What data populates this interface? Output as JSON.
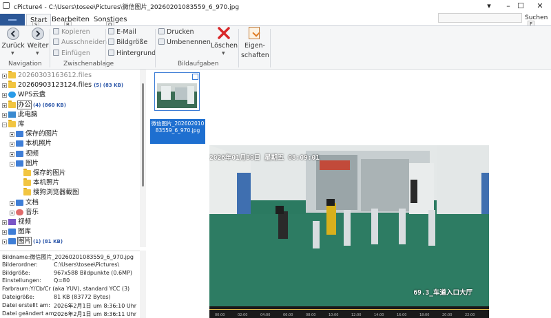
{
  "window": {
    "title": "cPicture4 - C:\\Users\\tosee\\Pictures\\微信图片_20260201083559_6_970.jpg",
    "minimize": "–",
    "maximize": "☐",
    "close": "✕"
  },
  "tabs": [
    {
      "label": "Start",
      "key": "S"
    },
    {
      "label": "Bearbeiten",
      "key": "B"
    },
    {
      "label": "Sonstiges",
      "key": "O"
    }
  ],
  "search": {
    "button_label": "Suchen",
    "key": "F",
    "value": ""
  },
  "ribbon": {
    "navigation": {
      "label": "Navigation",
      "back": "Zurück",
      "forward": "Weiter"
    },
    "clipboard": {
      "label": "Zwischenablage",
      "copy": "Kopieren",
      "cut": "Ausschneiden",
      "paste": "Einfügen"
    },
    "image": {
      "email": "E-Mail",
      "resize": "Bildgröße",
      "wallpaper": "Hintergrund"
    },
    "tasks": {
      "label": "Bildaufgaben",
      "print": "Drucken",
      "rename": "Umbenennen",
      "delete": "Löschen",
      "properties_line1": "Eigen-",
      "properties_line2": "schaften"
    }
  },
  "tree": [
    {
      "label": "20260303163612.files",
      "count": "",
      "icon": "folder",
      "exp": "plus"
    },
    {
      "label": "20260903123124.files",
      "count": "(5) (83 KB)",
      "icon": "folder",
      "exp": "plus"
    },
    {
      "label": "WPS云盘",
      "count": "",
      "icon": "cloud",
      "exp": "plus"
    },
    {
      "label": "办公",
      "count": "(4) (860 KB)",
      "icon": "folder",
      "exp": "plus"
    },
    {
      "label": "此电脑",
      "count": "",
      "icon": "pc",
      "exp": "plus"
    },
    {
      "label": "库",
      "count": "",
      "icon": "folder",
      "exp": "minus"
    },
    {
      "label": "保存的图片",
      "count": "",
      "icon": "lib",
      "exp": "plus"
    },
    {
      "label": "本机照片",
      "count": "",
      "icon": "lib",
      "exp": "plus"
    },
    {
      "label": "视频",
      "count": "",
      "icon": "lib",
      "exp": "plus"
    },
    {
      "label": "图片",
      "count": "",
      "icon": "lib",
      "exp": "minus"
    },
    {
      "label": "保存的图片",
      "count": "",
      "icon": "folder",
      "exp": ""
    },
    {
      "label": "本机照片",
      "count": "",
      "icon": "folder",
      "exp": ""
    },
    {
      "label": "搜狗浏览器截图",
      "count": "",
      "icon": "folder",
      "exp": ""
    },
    {
      "label": "文档",
      "count": "",
      "icon": "lib",
      "exp": "plus"
    },
    {
      "label": "音乐",
      "count": "",
      "icon": "music",
      "exp": "plus"
    },
    {
      "label": "视频",
      "count": "",
      "icon": "video",
      "exp": "plus"
    },
    {
      "label": "图库",
      "count": "",
      "icon": "lib",
      "exp": "plus"
    },
    {
      "label": "图片",
      "count": "(1) (81 KB)",
      "icon": "lib",
      "exp": "plus"
    }
  ],
  "info": [
    {
      "label": "Bildname:",
      "value": "微信图片_20260201083559_6_970.jpg",
      "wide": true
    },
    {
      "label": "Bilderordner:",
      "value": "C:\\Users\\tosee\\Pictures\\"
    },
    {
      "label": "Bildgröße:",
      "value": "967x588 Bildpunkte (0.6MP)"
    },
    {
      "label": "Einstellungen:",
      "value": "Q=80"
    },
    {
      "label": "Farbraum:",
      "value": "Y/Cb/Cr (aka YUV), standard YCC (3)",
      "wide": true
    },
    {
      "label": "Dateigröße:",
      "value": "81 KB (83772 Bytes)"
    },
    {
      "label": "Datei erstellt am:",
      "value": "2026年2月1日 um 8:36:10 Uhr"
    },
    {
      "label": "Datei geändert am:",
      "value": "2026年2月1日 um 8:36:11 Uhr"
    }
  ],
  "thumbnail": {
    "caption": "微信图片_20260201083559_6_970.jpg"
  },
  "preview": {
    "osd_time": "2026年01月30日  星期五  08:09:01",
    "osd_camera": "69.3_车道入口大厅",
    "timeline_ticks": [
      "00:00",
      "02:00",
      "04:00",
      "06:00",
      "08:00",
      "10:00",
      "12:00",
      "14:00",
      "16:00",
      "18:00",
      "20:00",
      "22:00"
    ]
  }
}
